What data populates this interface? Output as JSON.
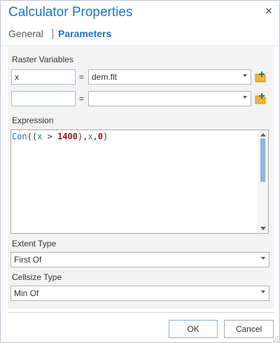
{
  "dialog": {
    "title": "Calculator Properties",
    "close_icon": "close-icon"
  },
  "tabs": {
    "general": "General",
    "parameters": "Parameters",
    "active": "parameters"
  },
  "raster_variables": {
    "label": "Raster Variables",
    "rows": [
      {
        "name": "x",
        "equals": "=",
        "value": "dem.flt"
      },
      {
        "name": "",
        "equals": "=",
        "value": ""
      }
    ]
  },
  "expression": {
    "label": "Expression",
    "tokens": {
      "fn": "Con",
      "open": "((",
      "var1": "x",
      "op": ">",
      "num1": "1400",
      "mid": "),",
      "var2": "x",
      "comma": ",",
      "num2": "0",
      "close": ")"
    }
  },
  "extent_type": {
    "label": "Extent Type",
    "value": "First Of"
  },
  "cellsize_type": {
    "label": "Cellsize Type",
    "value": "Min Of"
  },
  "buttons": {
    "ok": "OK",
    "cancel": "Cancel"
  },
  "colors": {
    "accent": "#1c75bc",
    "scroll_thumb": "#8fb5df",
    "add_icon": "#f2c94c"
  }
}
